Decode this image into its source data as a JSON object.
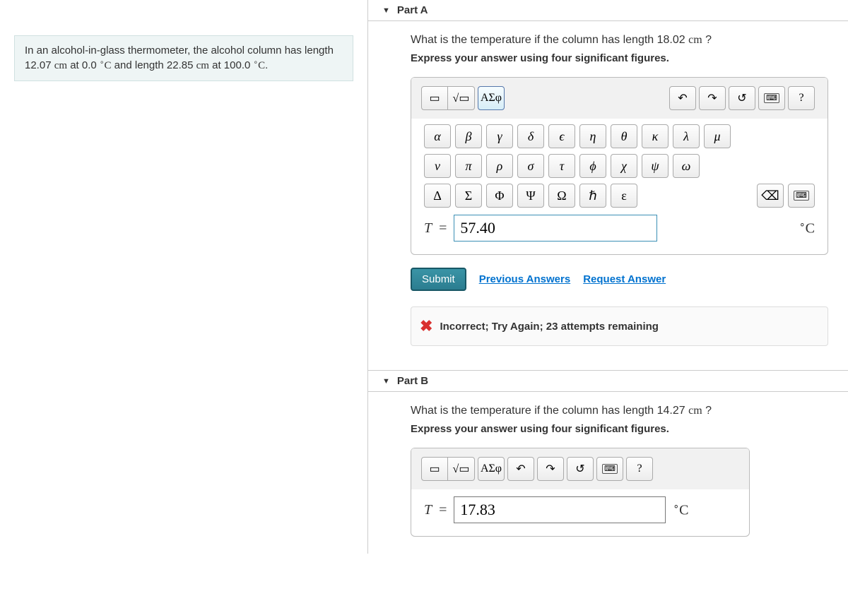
{
  "problem": {
    "text_a": "In an alcohol-in-glass thermometer, the alcohol column has length 12.07 ",
    "unit1": "cm",
    "text_b": " at 0.0 ",
    "deg1": "∘",
    "c1": "C",
    "text_c": " and length 22.85 ",
    "unit2": "cm",
    "text_d": " at 100.0 ",
    "deg2": "∘",
    "c2": "C",
    "text_e": "."
  },
  "partA": {
    "title": "Part A",
    "question_a": "What is the temperature if the column has length 18.02 ",
    "q_unit": "cm",
    "question_b": " ?",
    "instruction": "Express your answer using four significant figures.",
    "greek_label": "ΑΣφ",
    "help": "?",
    "symbols_row1": [
      "α",
      "β",
      "γ",
      "δ",
      "ϵ",
      "η",
      "θ",
      "κ",
      "λ",
      "μ"
    ],
    "symbols_row2": [
      "ν",
      "π",
      "ρ",
      "σ",
      "τ",
      "ϕ",
      "χ",
      "ψ",
      "ω"
    ],
    "symbols_row3": [
      "Δ",
      "Σ",
      "Φ",
      "Ψ",
      "Ω",
      "ℏ",
      "ε"
    ],
    "var": "T",
    "equals": " = ",
    "value": "57.40",
    "unit_pre": "∘",
    "unit": "C",
    "submit": "Submit",
    "prev": "Previous Answers",
    "req": "Request Answer",
    "feedback": "Incorrect; Try Again; 23 attempts remaining"
  },
  "partB": {
    "title": "Part B",
    "question_a": "What is the temperature if the column has length 14.27 ",
    "q_unit": "cm",
    "question_b": " ?",
    "instruction": "Express your answer using four significant figures.",
    "greek_label": "ΑΣφ",
    "help": "?",
    "var": "T",
    "equals": " = ",
    "value": "17.83",
    "unit_pre": "∘",
    "unit": "C"
  }
}
